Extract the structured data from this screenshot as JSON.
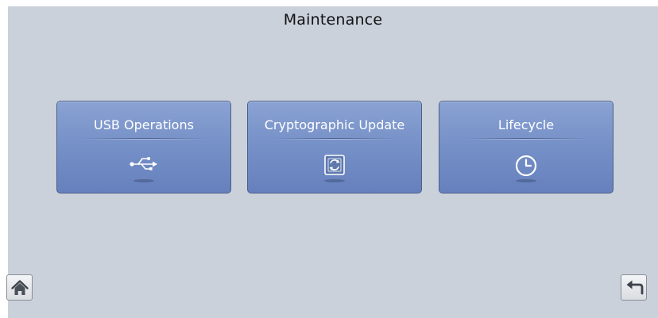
{
  "page": {
    "title": "Maintenance"
  },
  "tiles": [
    {
      "label": "USB Operations",
      "icon": "usb-icon"
    },
    {
      "label": "Cryptographic Update",
      "icon": "crypto-update-icon"
    },
    {
      "label": "Lifecycle",
      "icon": "clock-icon"
    }
  ],
  "nav": {
    "home_icon": "home-icon",
    "back_icon": "back-arrow-icon"
  },
  "colors": {
    "screen_background": "#cad1db",
    "tile_top": "#8aa2d3",
    "tile_bottom": "#6680bd",
    "tile_border": "#4c5f86",
    "tile_text": "#ffffff"
  }
}
